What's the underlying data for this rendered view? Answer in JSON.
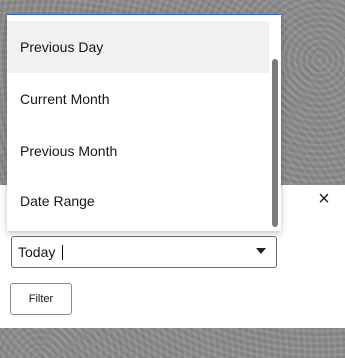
{
  "dialog": {
    "close_glyph": "×"
  },
  "date_filter": {
    "selected_value": "Today",
    "options": [
      "Previous Day",
      "Current Month",
      "Previous Month",
      "Date Range"
    ]
  },
  "actions": {
    "filter_label": "Filter"
  },
  "colors": {
    "dropdown_border_accent": "#2f6fd0",
    "hover_background": "#f1f1f1",
    "backdrop": "#8b8b8b"
  }
}
